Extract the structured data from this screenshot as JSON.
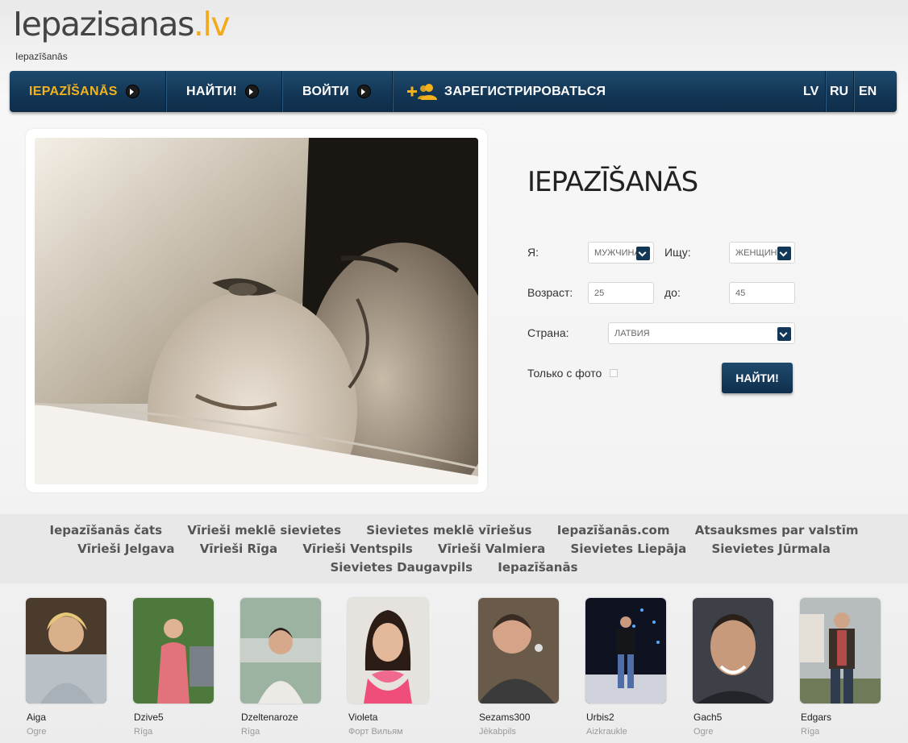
{
  "header": {
    "logo_main": "Iepazisanas",
    "logo_tld": ".lv",
    "subtitle": "Iepazīšanās"
  },
  "nav": {
    "items": [
      {
        "label": "IEPAZĪŠANĀS"
      },
      {
        "label": "НАЙТИ!"
      },
      {
        "label": "ВОЙТИ"
      },
      {
        "label": "ЗАРЕГИСТРИРОВАТЬСЯ"
      }
    ],
    "langs": [
      "LV",
      "RU",
      "EN"
    ]
  },
  "colors": {
    "nav_bg": "#133756",
    "accent": "#f2b21b"
  },
  "form": {
    "title": "IEPAZĪŠANĀS",
    "i_am_label": "Я:",
    "i_am_value": "МУЖЧИНА",
    "seeking_label": "Ищу:",
    "seeking_value": "ЖЕНЩИНУ",
    "age_label": "Возраст:",
    "age_from": "25",
    "age_to_label": "до:",
    "age_to": "45",
    "country_label": "Страна:",
    "country_value": "ЛАТВИЯ",
    "photo_only_label": "Только с фото",
    "submit_label": "НАЙТИ!"
  },
  "links": {
    "row1": [
      "Iepazīšanās čats",
      "Vīrieši meklē sievietes",
      "Sievietes meklē vīriešus",
      "Iepazīšanās.com",
      "Atsauksmes par valstīm"
    ],
    "row2": [
      "Vīrieši Jelgava",
      "Vīrieši Rīga",
      "Vīrieši Ventspils",
      "Vīrieši Valmiera",
      "Sievietes Liepāja",
      "Sievietes Jūrmala"
    ],
    "row3": [
      "Sievietes Daugavpils",
      "Iepazīšanās"
    ]
  },
  "profiles": [
    {
      "name": "Aiga",
      "city": "Ogre"
    },
    {
      "name": "Dzive5",
      "city": "Rīga"
    },
    {
      "name": "Dzeltenaroze",
      "city": "Rīga"
    },
    {
      "name": "Violeta",
      "city": "Форт Вильям"
    },
    {
      "name": "Sezams300",
      "city": "Jēkabpils"
    },
    {
      "name": "Urbis2",
      "city": "Aizkraukle"
    },
    {
      "name": "Gach5",
      "city": "Ogre"
    },
    {
      "name": "Edgars",
      "city": "Rīga"
    }
  ]
}
